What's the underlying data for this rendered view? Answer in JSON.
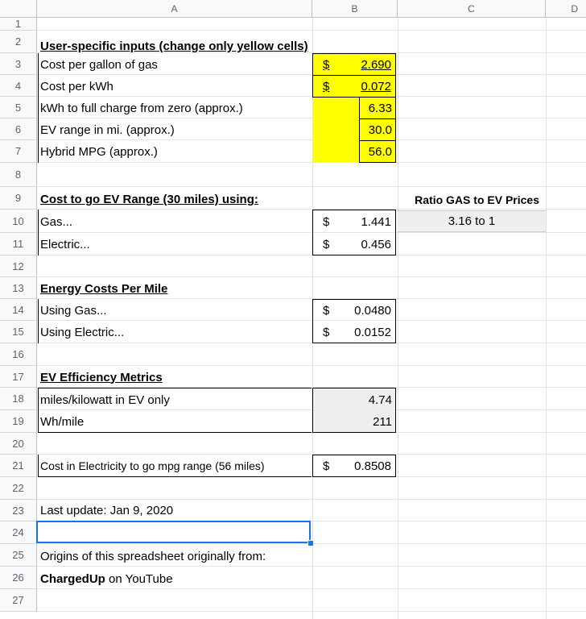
{
  "columns": [
    "A",
    "B",
    "C",
    "D"
  ],
  "rows": [
    "1",
    "2",
    "3",
    "4",
    "5",
    "6",
    "7",
    "8",
    "9",
    "10",
    "11",
    "12",
    "13",
    "14",
    "15",
    "16",
    "17",
    "18",
    "19",
    "20",
    "21",
    "22",
    "23",
    "24",
    "25",
    "26",
    "27"
  ],
  "inputs": {
    "heading": "User-specific inputs (change only yellow cells)",
    "gas_price": {
      "label": "Cost per gallon of gas",
      "currency": "$",
      "value": "2.690"
    },
    "kwh_price": {
      "label": "Cost per kWh",
      "currency": "$",
      "value": "0.072"
    },
    "kwh_full": {
      "label": "kWh to full charge from zero (approx.)",
      "value": "6.33"
    },
    "ev_range": {
      "label": "EV range in mi. (approx.)",
      "value": "30.0"
    },
    "hybrid_mpg": {
      "label": "Hybrid MPG (approx.)",
      "value": "56.0"
    }
  },
  "cost_range": {
    "heading": "Cost to go EV Range (30 miles) using:",
    "gas": {
      "label": "Gas...",
      "currency": "$",
      "value": "1.441"
    },
    "electric": {
      "label": "Electric...",
      "currency": "$",
      "value": "0.456"
    },
    "ratio_heading": "Ratio GAS to EV Prices",
    "ratio_value": "3.16 to 1"
  },
  "per_mile": {
    "heading": "Energy Costs Per Mile",
    "gas": {
      "label": "Using Gas...",
      "currency": "$",
      "value": "0.0480"
    },
    "electric": {
      "label": "Using Electric...",
      "currency": "$",
      "value": "0.0152"
    }
  },
  "efficiency": {
    "heading": "EV Efficiency Metrics",
    "miles_per_kw": {
      "label": "miles/kilowatt in EV only",
      "value": "4.74"
    },
    "wh_per_mile": {
      "label": "Wh/mile",
      "value": "211"
    }
  },
  "mpg_range": {
    "label": "Cost in Electricity to go mpg range (56 miles)",
    "currency": "$",
    "value": "0.8508"
  },
  "last_update": "Last update: Jan 9, 2020",
  "origins": "Origins of this spreadsheet originally from:",
  "credit": {
    "name": "ChargedUp",
    "rest": " on YouTube"
  },
  "colors": {
    "input_fill": "#ffff00",
    "calc_fill": "#efefef",
    "selection": "#1a73e8"
  }
}
